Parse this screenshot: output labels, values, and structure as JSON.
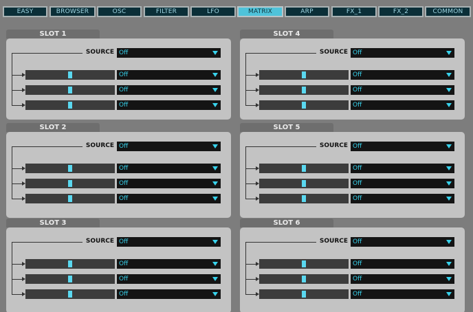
{
  "tabs": [
    {
      "label": "EASY",
      "active": false
    },
    {
      "label": "BROWSER",
      "active": false
    },
    {
      "label": "OSC",
      "active": false
    },
    {
      "label": "FILTER",
      "active": false
    },
    {
      "label": "LFO",
      "active": false
    },
    {
      "label": "MATRIX",
      "active": true
    },
    {
      "label": "ARP",
      "active": false
    },
    {
      "label": "FX_1",
      "active": false
    },
    {
      "label": "FX_2",
      "active": false
    },
    {
      "label": "COMMON",
      "active": false
    }
  ],
  "source_label": "SOURCE",
  "slots": [
    {
      "title": "SLOT 1",
      "source": "Off",
      "rows": [
        {
          "amount": 0.5,
          "dest": "Off"
        },
        {
          "amount": 0.5,
          "dest": "Off"
        },
        {
          "amount": 0.5,
          "dest": "Off"
        }
      ]
    },
    {
      "title": "SLOT 4",
      "source": "Off",
      "rows": [
        {
          "amount": 0.5,
          "dest": "Off"
        },
        {
          "amount": 0.5,
          "dest": "Off"
        },
        {
          "amount": 0.5,
          "dest": "Off"
        }
      ]
    },
    {
      "title": "SLOT 2",
      "source": "Off",
      "rows": [
        {
          "amount": 0.5,
          "dest": "Off"
        },
        {
          "amount": 0.5,
          "dest": "Off"
        },
        {
          "amount": 0.5,
          "dest": "Off"
        }
      ]
    },
    {
      "title": "SLOT 5",
      "source": "Off",
      "rows": [
        {
          "amount": 0.5,
          "dest": "Off"
        },
        {
          "amount": 0.5,
          "dest": "Off"
        },
        {
          "amount": 0.5,
          "dest": "Off"
        }
      ]
    },
    {
      "title": "SLOT 3",
      "source": "Off",
      "rows": [
        {
          "amount": 0.5,
          "dest": "Off"
        },
        {
          "amount": 0.5,
          "dest": "Off"
        },
        {
          "amount": 0.5,
          "dest": "Off"
        }
      ]
    },
    {
      "title": "SLOT 6",
      "source": "Off",
      "rows": [
        {
          "amount": 0.5,
          "dest": "Off"
        },
        {
          "amount": 0.5,
          "dest": "Off"
        },
        {
          "amount": 0.5,
          "dest": "Off"
        }
      ]
    }
  ],
  "colors": {
    "accent": "#4fc3da",
    "tab_bg": "#0b2f38",
    "panel_bg": "#c3c3c3",
    "dropdown_text": "#38d2ec"
  }
}
